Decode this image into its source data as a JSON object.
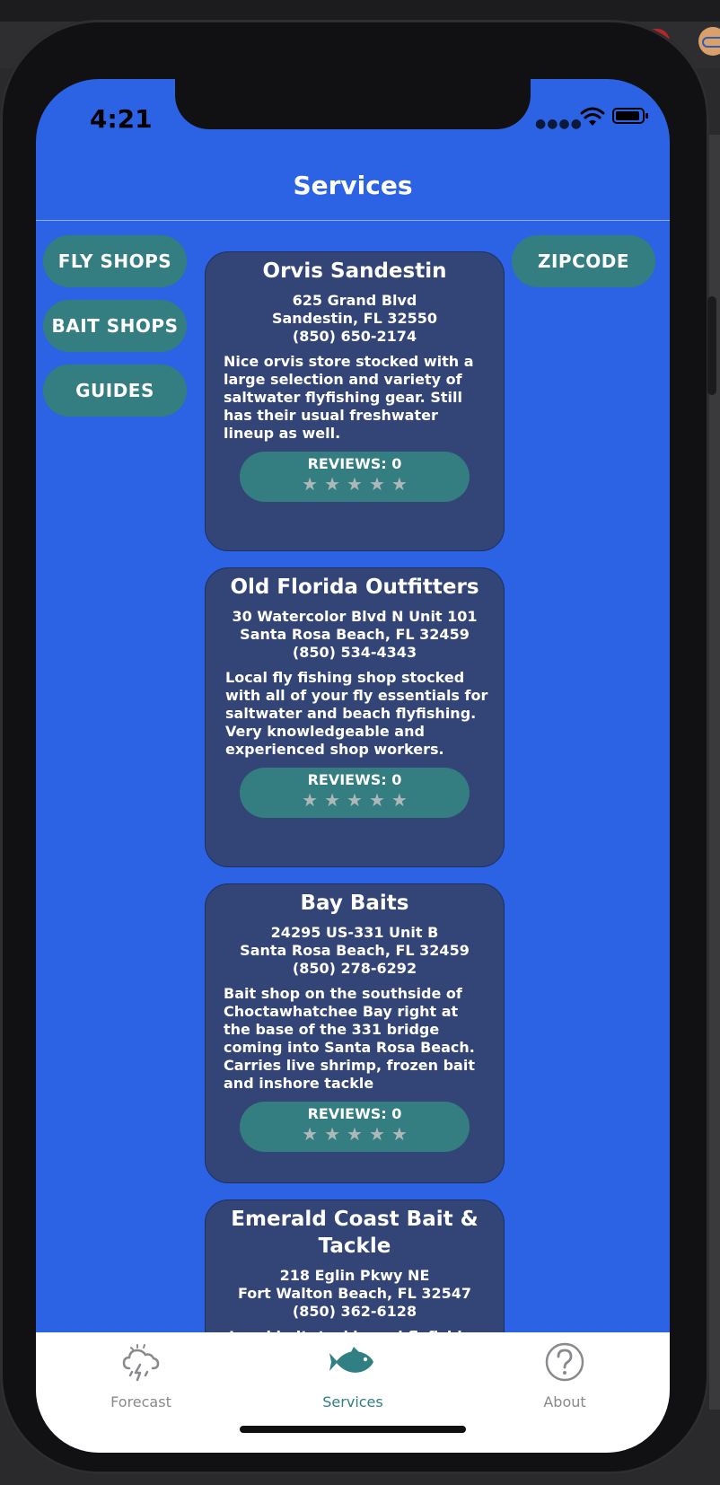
{
  "status": {
    "time": "4:21"
  },
  "nav": {
    "title": "Services"
  },
  "filters": {
    "fly_shops": "FLY SHOPS",
    "bait_shops": "BAIT SHOPS",
    "guides": "GUIDES",
    "zipcode": "ZIPCODE"
  },
  "cards": [
    {
      "name": "Orvis Sandestin",
      "address1": "625 Grand Blvd",
      "address2": "Sandestin, FL 32550",
      "phone": "(850) 650-2174",
      "description": "Nice orvis store stocked with a large selection and variety of saltwater flyfishing gear. Still has their usual freshwater lineup as well.",
      "reviews": "REVIEWS: 0",
      "stars": "★★★★★",
      "rating": 0
    },
    {
      "name": "Old Florida Outfitters",
      "address1": "30 Watercolor Blvd N Unit 101",
      "address2": "Santa Rosa Beach, FL 32459",
      "phone": "(850) 534-4343",
      "description": "Local fly fishing shop stocked with all of your fly essentials for saltwater and beach flyfishing. Very knowledgeable and experienced shop workers.",
      "reviews": "REVIEWS: 0",
      "stars": "★★★★★",
      "rating": 0
    },
    {
      "name": "Bay Baits",
      "address1": "24295 US-331 Unit B",
      "address2": "Santa Rosa Beach, FL 32459",
      "phone": "(850) 278-6292",
      "description": "Bait shop on the southside of Choctawhatchee Bay right at the base of the 331 bridge coming into Santa Rosa Beach. Carries live shrimp, frozen bait and inshore tackle",
      "reviews": "REVIEWS: 0",
      "stars": "★★★★★",
      "rating": 0
    },
    {
      "name": "Emerald Coast Bait & Tackle",
      "address1": "218 Eglin Pkwy NE",
      "address2": "Fort Walton Beach, FL 32547",
      "phone": "(850) 362-6128",
      "description": "Local bait, tackle and flyfishing"
    }
  ],
  "tabs": {
    "forecast": "Forecast",
    "services": "Services",
    "about": "About"
  },
  "colors": {
    "background": "#2c63e5",
    "card": "#334476",
    "accent": "#347d80",
    "tab_active": "#2f7f83",
    "tab_inactive": "#8a8a8e"
  },
  "icons": {
    "forecast": "storm-cloud-icon",
    "services": "fish-icon",
    "about": "question-circle-icon"
  }
}
